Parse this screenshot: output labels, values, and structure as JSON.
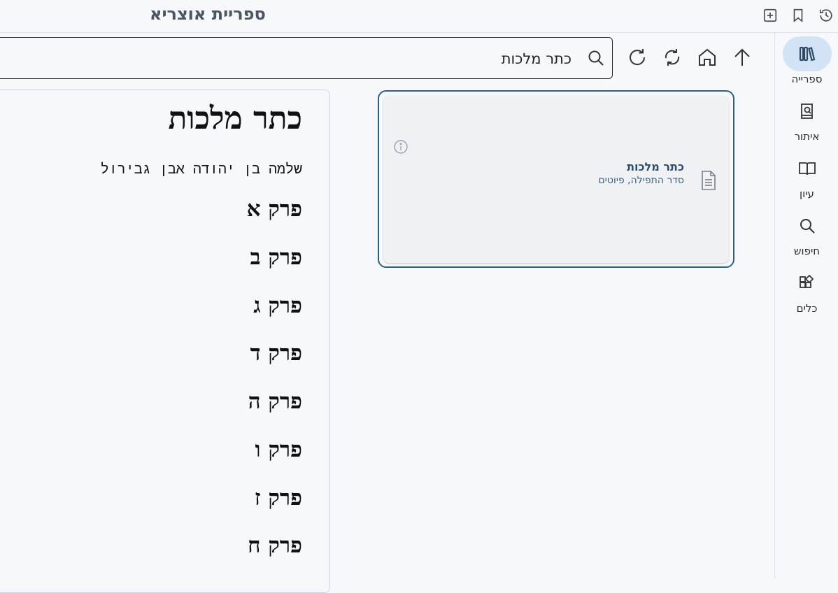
{
  "app": {
    "title": "ספריית אוצריא"
  },
  "top_actions": [
    {
      "name": "history-icon"
    },
    {
      "name": "bookmark-icon"
    },
    {
      "name": "new-tab-icon"
    }
  ],
  "sidebar": {
    "items": [
      {
        "label": "ספרייה",
        "icon": "library-icon",
        "active": true
      },
      {
        "label": "איתור",
        "icon": "find-book-icon",
        "active": false
      },
      {
        "label": "עיון",
        "icon": "open-book-icon",
        "active": false
      },
      {
        "label": "חיפוש",
        "icon": "search-icon",
        "active": false
      },
      {
        "label": "כלים",
        "icon": "tools-icon",
        "active": false
      }
    ]
  },
  "toolbar": {
    "icons": [
      "up-arrow-icon",
      "home-icon",
      "sync-icon",
      "refresh-icon"
    ]
  },
  "search": {
    "value": "כתר מלכות"
  },
  "result_card": {
    "title": "כתר מלכות",
    "subtitle": "סדר התפילה, פיוטים"
  },
  "preview": {
    "title": "כתר מלכות",
    "author": "שלמה בן יהודה אבן גבירול",
    "chapters": [
      "פרק א",
      "פרק ב",
      "פרק ג",
      "פרק ד",
      "פרק ה",
      "פרק ו",
      "פרק ז",
      "פרק ח"
    ]
  },
  "colors": {
    "accent": "#2c5e88",
    "active_pill": "#d3e3f7"
  }
}
